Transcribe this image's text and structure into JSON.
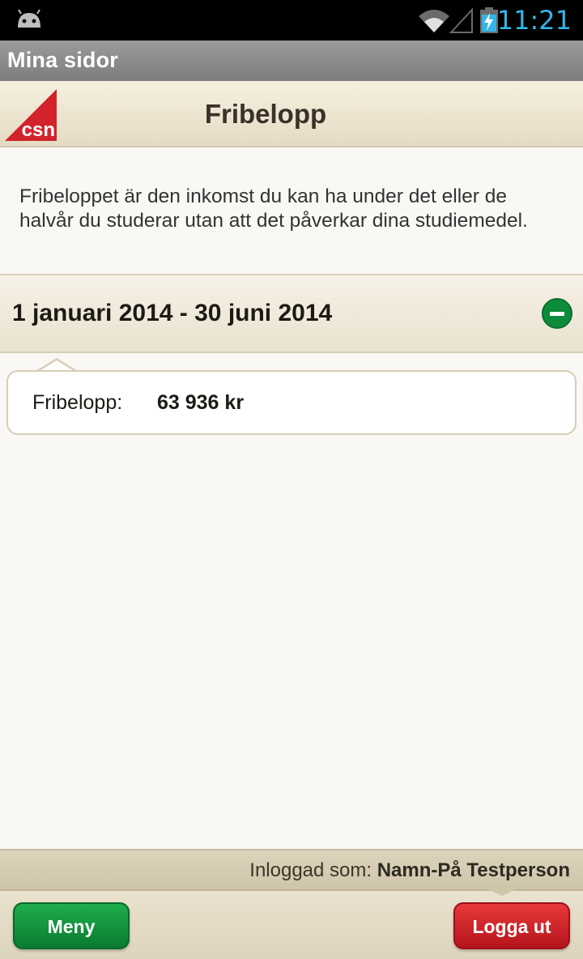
{
  "status_bar": {
    "time": "11:21",
    "icons": [
      "android-icon",
      "wifi-icon",
      "signal-icon",
      "battery-charging-icon"
    ],
    "clock_color": "#33b5e5"
  },
  "action_bar": {
    "title": "Mina sidor"
  },
  "header": {
    "logo_text": "csn",
    "title": "Fribelopp",
    "logo_color": "#d2232a"
  },
  "intro": {
    "text": "Fribeloppet är den inkomst du kan ha under det eller de halvår du studerar utan att det påverkar dina studiemedel."
  },
  "period": {
    "label": "1 januari 2014 - 30 juni 2014",
    "expanded_icon": "minus-circle-icon"
  },
  "details": {
    "key": "Fribelopp:",
    "value": "63 936 kr"
  },
  "logged_in": {
    "prefix": "Inloggad som:",
    "name": "Namn-På Testperson"
  },
  "footer": {
    "menu_label": "Meny",
    "logout_label": "Logga ut",
    "menu_color": "#0c8c3a",
    "logout_color": "#c8202a"
  }
}
